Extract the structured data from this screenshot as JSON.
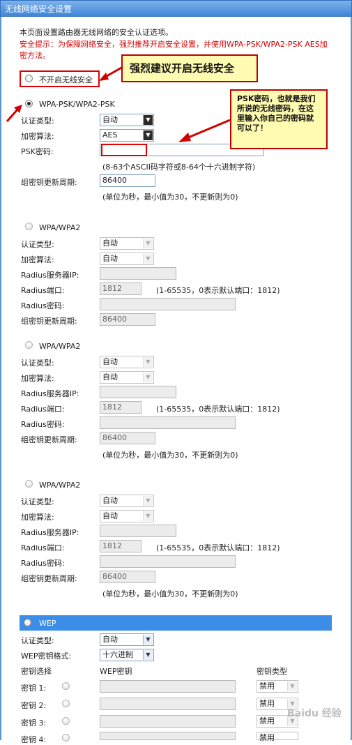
{
  "window_title": "无线网络安全设置",
  "intro": {
    "description": "本页面设置路由器无线网络的安全认证选项。",
    "warning": "安全提示：为保障网络安全，强烈推荐开启安全设置，并使用WPA-PSK/WPA2-PSK AES加密方法。"
  },
  "no_security": {
    "label": "不开启无线安全",
    "selected": false
  },
  "wpa_psk": {
    "label": "WPA-PSK/WPA2-PSK",
    "selected": true,
    "auth_label": "认证类型:",
    "auth_value": "自动",
    "enc_label": "加密算法:",
    "enc_value": "AES",
    "psk_label": "PSK密码:",
    "psk_value": "",
    "psk_hint": "(8-63个ASCII码字符或8-64个十六进制字符)",
    "renew_label": "组密钥更新周期:",
    "renew_value": "86400",
    "renew_hint": "(单位为秒，最小值为30，不更新则为0)"
  },
  "wpa_blocks": [
    {
      "label": "WPA/WPA2",
      "auth_label": "认证类型:",
      "auth_value": "自动",
      "enc_label": "加密算法:",
      "enc_value": "自动",
      "radius_ip_label": "Radius服务器IP:",
      "radius_ip_value": "",
      "radius_port_label": "Radius端口:",
      "radius_port_value": "1812",
      "radius_port_hint": "(1-65535，0表示默认端口：1812)",
      "radius_pwd_label": "Radius密码:",
      "radius_pwd_value": "",
      "renew_label": "组密钥更新周期:",
      "renew_value": "86400"
    },
    {
      "label": "WPA/WPA2",
      "auth_label": "认证类型:",
      "auth_value": "自动",
      "enc_label": "加密算法:",
      "enc_value": "自动",
      "radius_ip_label": "Radius服务器IP:",
      "radius_ip_value": "",
      "radius_port_label": "Radius端口:",
      "radius_port_value": "1812",
      "radius_port_hint": "(1-65535，0表示默认端口：1812)",
      "radius_pwd_label": "Radius密码:",
      "radius_pwd_value": "",
      "renew_label": "组密钥更新周期:",
      "renew_value": "86400",
      "renew_hint": "(单位为秒，最小值为30，不更新则为0)"
    },
    {
      "label": "WPA/WPA2",
      "auth_label": "认证类型:",
      "auth_value": "自动",
      "enc_label": "加密算法:",
      "enc_value": "自动",
      "radius_ip_label": "Radius服务器IP:",
      "radius_ip_value": "",
      "radius_port_label": "Radius端口:",
      "radius_port_value": "1812",
      "radius_port_hint": "(1-65535，0表示默认端口：1812)",
      "radius_pwd_label": "Radius密码:",
      "radius_pwd_value": "",
      "renew_label": "组密钥更新周期:",
      "renew_value": "86400",
      "renew_hint": "(单位为秒，最小值为30，不更新则为0)"
    }
  ],
  "wep": {
    "label": "WEP",
    "auth_label": "认证类型:",
    "auth_value": "自动",
    "format_label": "WEP密钥格式:",
    "format_value": "十六进制",
    "col_select": "密钥选择",
    "col_key": "WEP密钥",
    "col_type": "密钥类型",
    "keys": [
      {
        "label": "密钥 1:",
        "type": "禁用"
      },
      {
        "label": "密钥 2:",
        "type": "禁用"
      },
      {
        "label": "密钥 3:",
        "type": "禁用"
      },
      {
        "label": "密钥 4:",
        "type": "禁用"
      }
    ]
  },
  "annotations": {
    "callout_main": "强烈建议开启无线安全",
    "callout_psk": "PSK密码，也就是我们所说的无线密码，在这里输入你自己的密码就可以了！"
  },
  "watermark": "Baidu 经验"
}
